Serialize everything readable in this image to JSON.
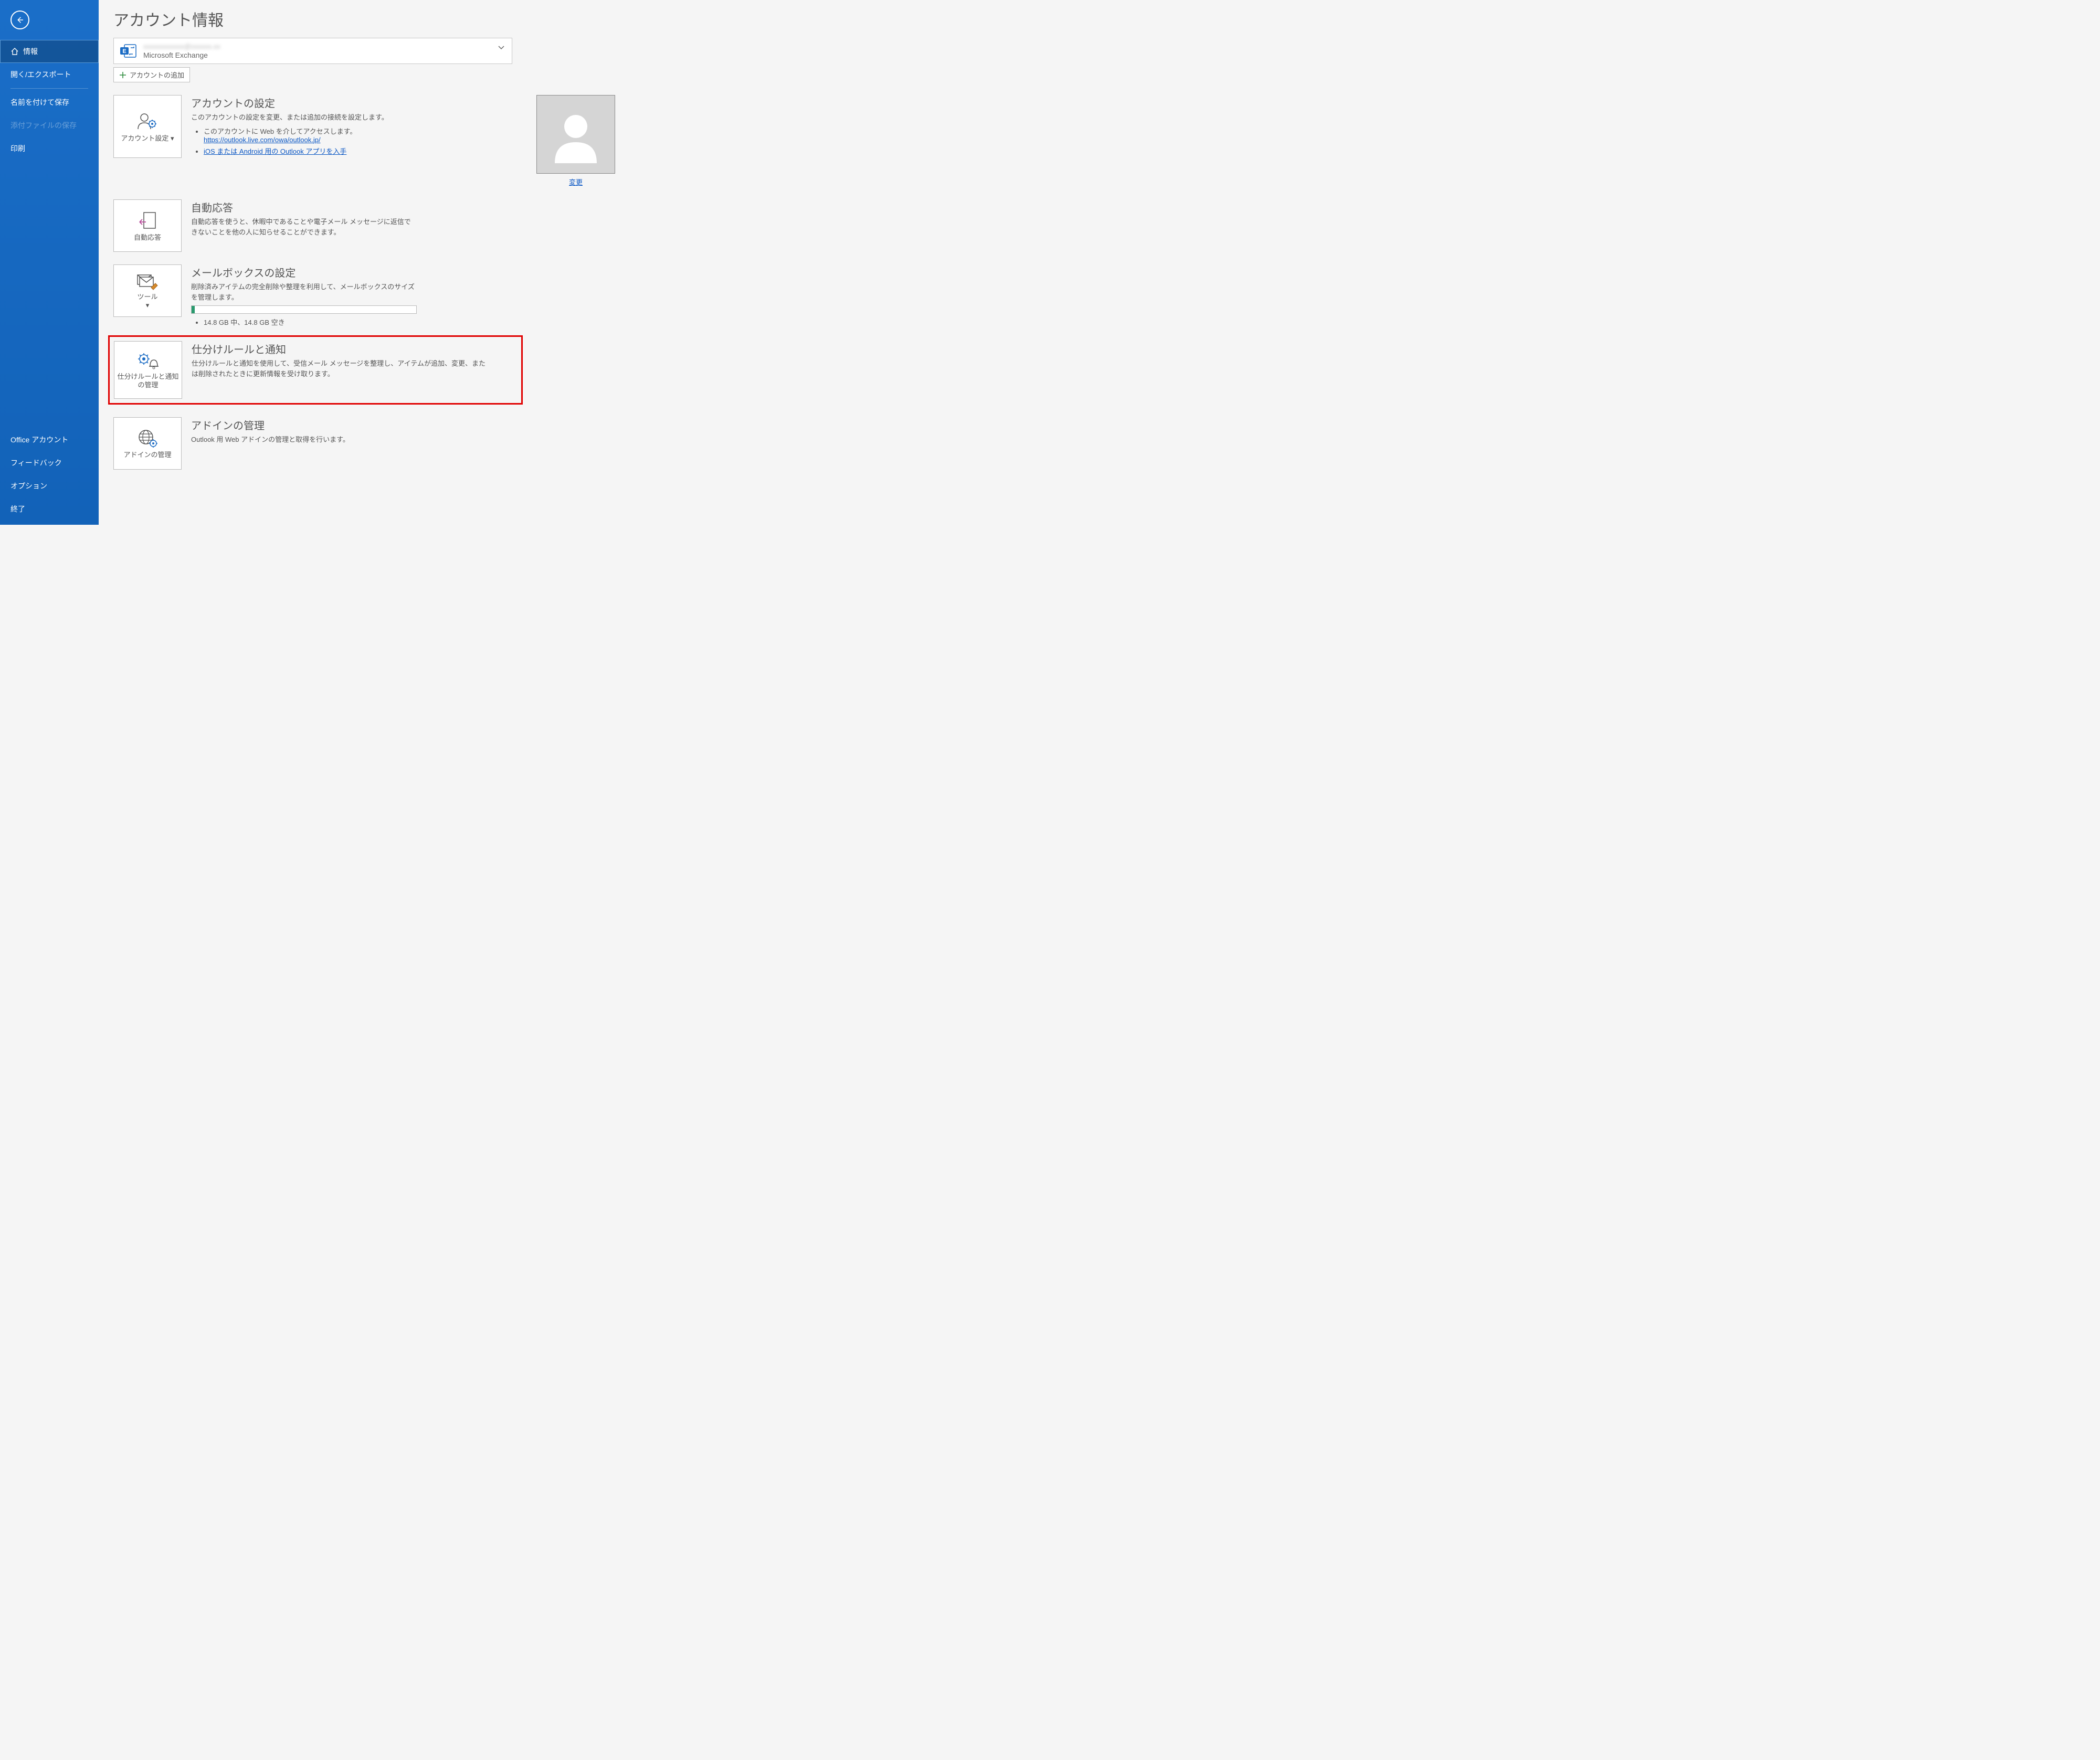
{
  "page_title": "アカウント情報",
  "sidebar": {
    "nav": [
      {
        "label": "情報",
        "name": "sidebar-item-info",
        "selected": true,
        "icon": "home"
      },
      {
        "label": "開く/エクスポート",
        "name": "sidebar-item-open-export"
      },
      {
        "divider": true
      },
      {
        "label": "名前を付けて保存",
        "name": "sidebar-item-save-as"
      },
      {
        "label": "添付ファイルの保存",
        "name": "sidebar-item-save-attachments",
        "disabled": true
      },
      {
        "label": "印刷",
        "name": "sidebar-item-print"
      }
    ],
    "bottom": [
      {
        "label": "Office アカウント",
        "name": "sidebar-item-office-account"
      },
      {
        "label": "フィードバック",
        "name": "sidebar-item-feedback"
      },
      {
        "label": "オプション",
        "name": "sidebar-item-options"
      },
      {
        "label": "終了",
        "name": "sidebar-item-exit"
      }
    ]
  },
  "account_picker": {
    "email_masked": "xxxxxxxxxxxx@xxxxxx.xx",
    "type": "Microsoft Exchange"
  },
  "add_account_label": "アカウントの追加",
  "sections": {
    "account_settings": {
      "tile_label": "アカウント設定",
      "title": "アカウントの設定",
      "desc": "このアカウントの設定を変更、または追加の接続を設定します。",
      "bullet1_prefix": "このアカウントに Web を介してアクセスします。",
      "link1": "https://outlook.live.com/owa/outlook.jp/",
      "link2": "iOS または Android 用の Outlook アプリを入手",
      "change": "変更"
    },
    "auto_reply": {
      "tile_label": "自動応答",
      "title": "自動応答",
      "desc": "自動応答を使うと、休暇中であることや電子メール メッセージに返信できないことを他の人に知らせることができます。"
    },
    "mailbox": {
      "tile_label": "ツール",
      "title": "メールボックスの設定",
      "desc": "削除済みアイテムの完全削除や整理を利用して、メールボックスのサイズを管理します。",
      "quota": "14.8 GB 中、14.8 GB 空き"
    },
    "rules": {
      "tile_label": "仕分けルールと通知の管理",
      "title": "仕分けルールと通知",
      "desc": "仕分けルールと通知を使用して、受信メール メッセージを整理し、アイテムが追加、変更、または削除されたときに更新情報を受け取ります。"
    },
    "addins": {
      "tile_label": "アドインの管理",
      "title": "アドインの管理",
      "desc": "Outlook 用 Web アドインの管理と取得を行います。"
    }
  }
}
